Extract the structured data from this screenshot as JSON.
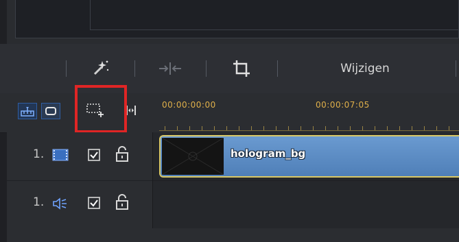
{
  "toolbar": {
    "modify_label": "Wijzigen",
    "icons": [
      "magic-wand-icon",
      "split-icon",
      "crop-icon"
    ]
  },
  "timeline": {
    "timecodes": [
      "00:00:00:00",
      "00:00:07:05"
    ],
    "tools": [
      "ruler-icon",
      "clip-mode-icon",
      "add-track-icon",
      "fit-width-icon"
    ]
  },
  "tracks": [
    {
      "number": "1.",
      "type": "video",
      "icon": "film-icon",
      "checked": true,
      "locked": false
    },
    {
      "number": "1.",
      "type": "audio",
      "icon": "speaker-icon",
      "checked": true,
      "locked": false
    }
  ],
  "clip": {
    "label": "hologram_bg"
  },
  "colors": {
    "accent": "#2f5ea3",
    "timecode": "#e0b04a",
    "clip_border": "#d9c867",
    "clip_fill": "#5a8ac4",
    "highlight": "#e02525"
  }
}
